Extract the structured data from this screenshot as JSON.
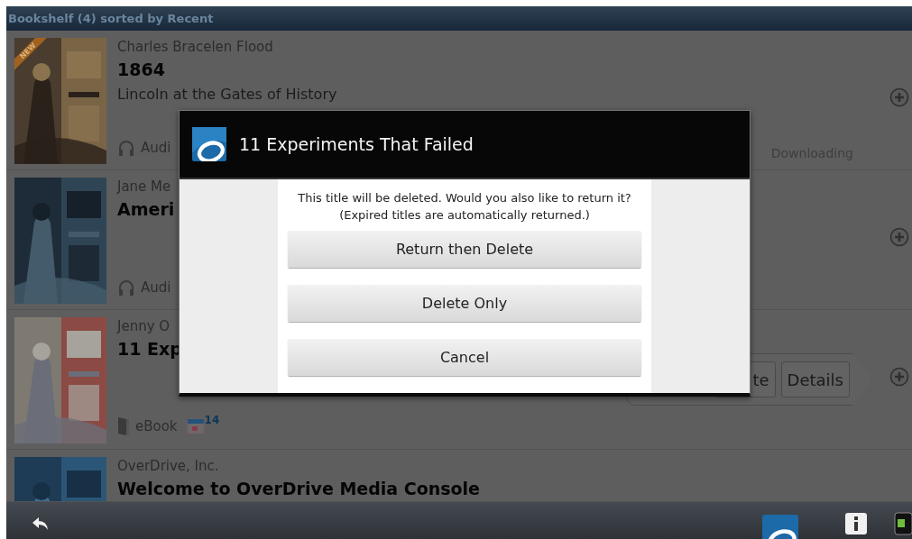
{
  "header": {
    "title": "Bookshelf (4) sorted by Recent"
  },
  "books": [
    {
      "author": "Charles Bracelen Flood",
      "title": "1864",
      "subtitle": "Lincoln at the Gates of History",
      "badge": "NEW",
      "cover": {
        "kind": "picture"
      },
      "format": {
        "kind": "audiobook",
        "label": "Audi"
      },
      "status": "Downloading"
    },
    {
      "author": "Jane Me",
      "title": "Ameri",
      "cover": {
        "kind": "picture"
      },
      "format": {
        "kind": "audiobook",
        "label": "Audi"
      }
    },
    {
      "author": "Jenny O",
      "title": "11 Exp",
      "cover": {
        "kind": "picture"
      },
      "format": {
        "kind": "ebook",
        "label": "eBook"
      },
      "loan_days": "14",
      "actions": [
        {
          "label": "te"
        },
        {
          "label": "Details"
        }
      ]
    },
    {
      "author": "OverDrive, Inc.",
      "title": "Welcome to OverDrive Media Console",
      "cover": {
        "kind": "picture"
      }
    }
  ],
  "dialog": {
    "title": "11 Experiments That Failed",
    "message": [
      "This title will be deleted. Would you also like to return it?",
      "(Expired titles are automatically returned.)"
    ],
    "buttons": [
      "Return then Delete",
      "Delete Only",
      "Cancel"
    ]
  }
}
